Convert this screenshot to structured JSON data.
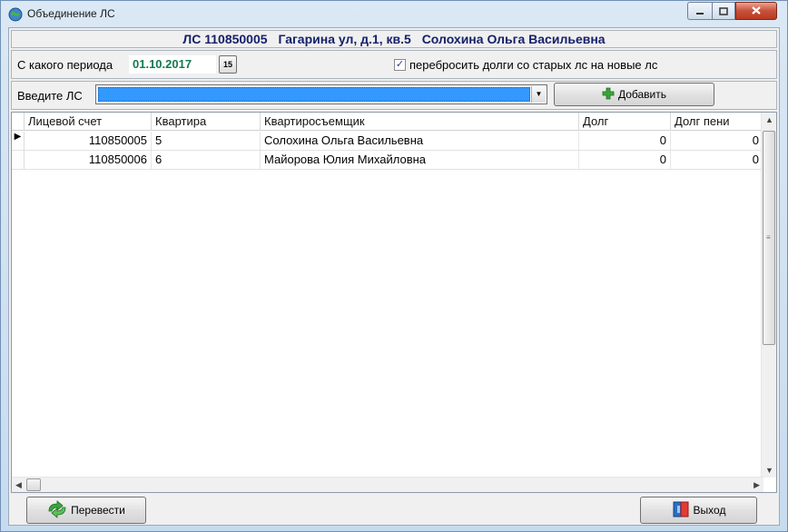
{
  "window": {
    "title": "Объединение ЛС"
  },
  "header": {
    "account": "ЛС 110850005",
    "address": "Гагарина ул, д.1, кв.5",
    "owner": "Солохина Ольга Васильевна"
  },
  "period": {
    "label": "С какого периода",
    "value": "01.10.2017",
    "calendar_glyph": "15"
  },
  "transfer_debts": {
    "label": "перебросить долги со старых лс на новые лс",
    "checked": true
  },
  "account_input": {
    "label": "Введите ЛС",
    "value": "",
    "add_label": "Добавить"
  },
  "grid": {
    "columns": [
      "Лицевой счет",
      "Квартира",
      "Квартиросъемщик",
      "Долг",
      "Долг пени"
    ],
    "rows": [
      {
        "account": "110850005",
        "apartment": "5",
        "tenant": "Солохина Ольга Васильевна",
        "debt": "0",
        "penalty": "0"
      },
      {
        "account": "110850006",
        "apartment": "6",
        "tenant": "Майорова Юлия Михайловна",
        "debt": "0",
        "penalty": "0"
      }
    ]
  },
  "footer": {
    "transfer_label": "Перевести",
    "exit_label": "Выход"
  },
  "colors": {
    "header_text": "#14216b",
    "date_text": "#127a4f",
    "selection": "#3399ff",
    "add_icon": "#3aa53a"
  },
  "icons": {
    "app": "globe-icon",
    "add": "plus-icon",
    "transfer": "swap-arrows-icon",
    "exit": "exit-door-icon"
  }
}
